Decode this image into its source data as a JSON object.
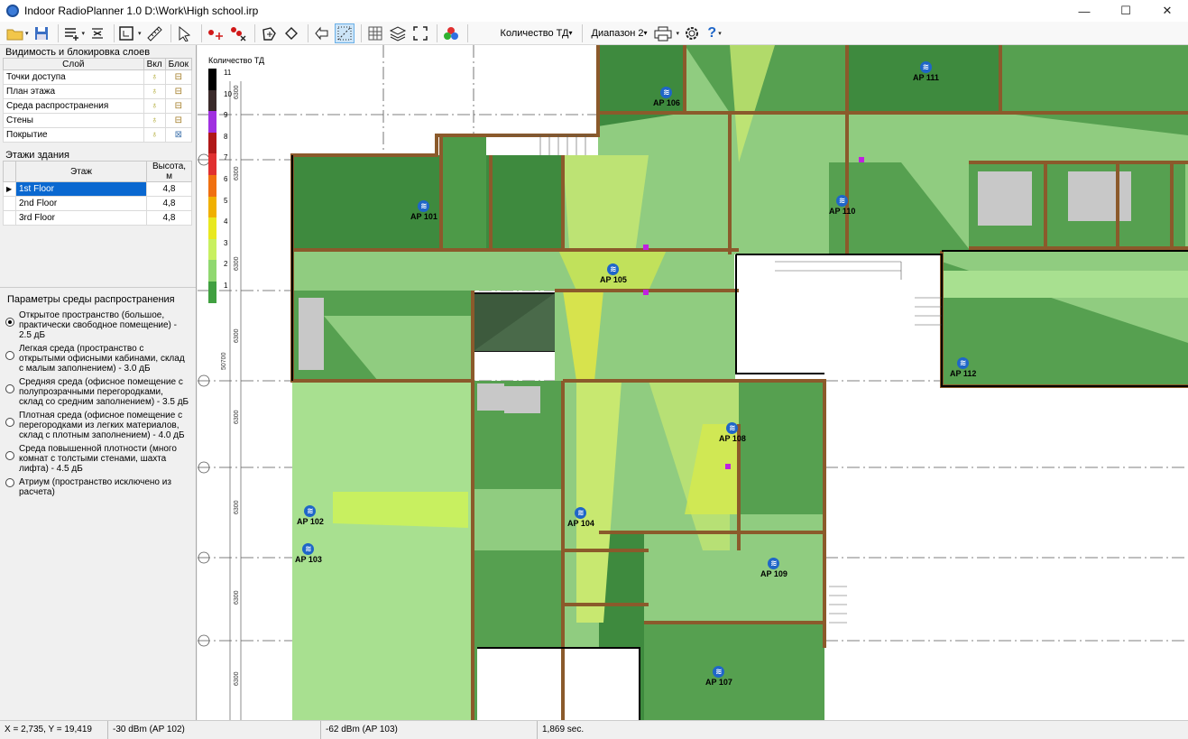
{
  "window": {
    "title": "Indoor RadioPlanner 1.0 D:\\Work\\High school.irp",
    "minimize": "—",
    "maximize": "☐",
    "close": "✕"
  },
  "toolbar": {
    "icons": [
      "open-folder-icon",
      "save-icon",
      "layers-menu-icon",
      "distribute-icon",
      "floor-plan-icon",
      "ruler-icon",
      "select-arrow-icon",
      "add-ap-icon",
      "delete-ap-icon",
      "add-polygon-icon",
      "edit-polygon-icon",
      "back-icon",
      "grid-dots-icon",
      "grid-icon",
      "layers-icon",
      "fit-icon",
      "color-palette-icon",
      "printer-icon",
      "settings-icon",
      "help-icon"
    ],
    "mode_select": "Количество ТД",
    "band_select": "Диапазон 2",
    "help": "?"
  },
  "layers": {
    "title": "Видимость и блокировка слоев",
    "col_layer": "Слой",
    "col_on": "Вкл",
    "col_lock": "Блок",
    "rows": [
      {
        "name": "Точки доступа"
      },
      {
        "name": "План этажа"
      },
      {
        "name": "Среда распространения"
      },
      {
        "name": "Стены"
      },
      {
        "name": "Покрытие"
      }
    ]
  },
  "floors": {
    "title": "Этажи здания",
    "col_floor": "Этаж",
    "col_height": "Высота, м",
    "rows": [
      {
        "name": "1st Floor",
        "height": "4,8"
      },
      {
        "name": "2nd Floor",
        "height": "4,8"
      },
      {
        "name": "3rd Floor",
        "height": "4,8"
      }
    ]
  },
  "env": {
    "title": "Параметры среды распространения",
    "options": [
      "Открытое пространство (большое, практически свободное помещение) - 2.5 дБ",
      "Легкая среда (пространство с открытыми офисными кабинами, склад с малым заполнением) - 3.0 дБ",
      "Средняя среда (офисное помещение с полупрозрачными перегородками, склад со средним заполнением) - 3.5 дБ",
      "Плотная среда (офисное помещение с перегородками из легких материалов, склад с плотным заполнением) - 4.0 дБ",
      "Среда повышенной плотности (много комнат с толстыми стенами, шахта лифта) - 4.5 дБ",
      "Атриум (пространство исключено из расчета)"
    ],
    "selected": 0
  },
  "legend": {
    "title": "Количество ТД",
    "labels": [
      "11",
      "10",
      "9",
      "8",
      "7",
      "6",
      "5",
      "4",
      "3",
      "2",
      "1"
    ],
    "colors": [
      "#000000",
      "#3a2a2a",
      "#a030e0",
      "#b01818",
      "#e03030",
      "#f07010",
      "#f0b000",
      "#e8e820",
      "#c8f060",
      "#90d870",
      "#40a040"
    ]
  },
  "aps": [
    {
      "label": "AP 101"
    },
    {
      "label": "AP 102"
    },
    {
      "label": "AP 103"
    },
    {
      "label": "AP 104"
    },
    {
      "label": "AP 105"
    },
    {
      "label": "AP 106"
    },
    {
      "label": "AP 107"
    },
    {
      "label": "AP 108"
    },
    {
      "label": "AP 109"
    },
    {
      "label": "AP 110"
    },
    {
      "label": "AP 111"
    },
    {
      "label": "AP 112"
    }
  ],
  "dims": [
    "6300",
    "6300",
    "6300",
    "6300",
    "6300",
    "6300",
    "6300",
    "6300",
    "50700"
  ],
  "status": {
    "coords": "X = 2,735, Y = 19,419",
    "sig1": "-30 dBm (AP 102)",
    "sig2": "-62 dBm (AP 103)",
    "time": "1,869 sec."
  }
}
